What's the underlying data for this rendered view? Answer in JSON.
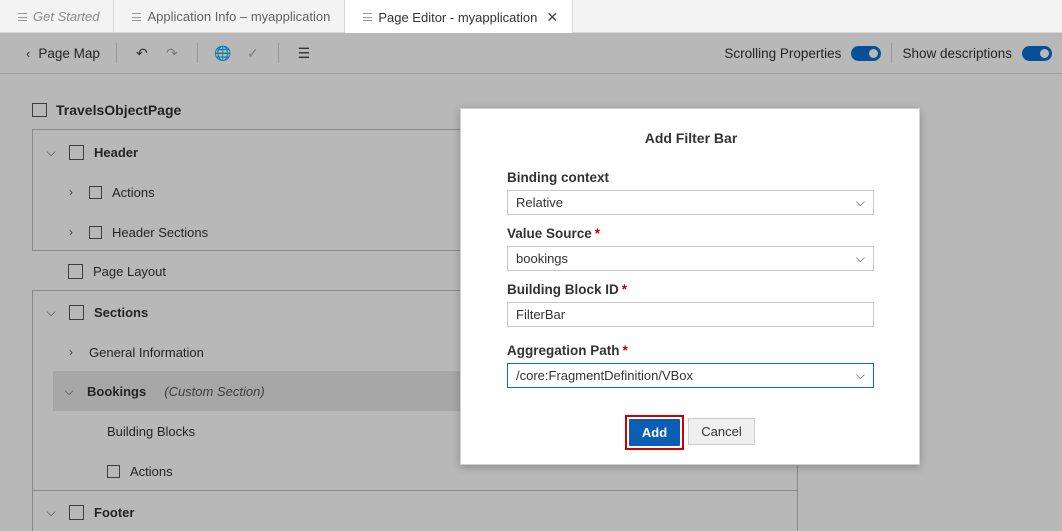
{
  "tabs": [
    {
      "label": "Get Started",
      "style": "italic"
    },
    {
      "label": "Application Info – myapplication",
      "style": "normal"
    },
    {
      "label": "Page Editor - myapplication",
      "style": "active"
    }
  ],
  "toolbar": {
    "page_map_label": "Page Map",
    "scrolling_properties_label": "Scrolling Properties",
    "show_descriptions_label": "Show descriptions",
    "scrolling_properties_on": true,
    "show_descriptions_on": true
  },
  "tree": {
    "title": "TravelsObjectPage",
    "header": {
      "label": "Header",
      "children": [
        "Actions",
        "Header Sections"
      ]
    },
    "page_layout": "Page Layout",
    "sections": {
      "label": "Sections",
      "general_information": "General Information",
      "bookings": "Bookings",
      "bookings_sub": "(Custom Section)",
      "building_blocks": "Building Blocks",
      "actions": "Actions"
    },
    "footer": "Footer"
  },
  "dialog": {
    "title": "Add Filter Bar",
    "binding_context": {
      "label": "Binding context",
      "value": "Relative"
    },
    "value_source": {
      "label": "Value Source",
      "value": "bookings",
      "required": "*"
    },
    "building_block_id": {
      "label": "Building Block ID",
      "value": "FilterBar",
      "required": "*"
    },
    "aggregation_path": {
      "label": "Aggregation Path",
      "value": "/core:FragmentDefinition/VBox",
      "required": "*"
    },
    "add_label": "Add",
    "cancel_label": "Cancel"
  },
  "colors": {
    "accent": "#0a6ed1",
    "add_button": "#0a5fb4",
    "highlight_border": "#d00000",
    "required": "#bb0000"
  }
}
